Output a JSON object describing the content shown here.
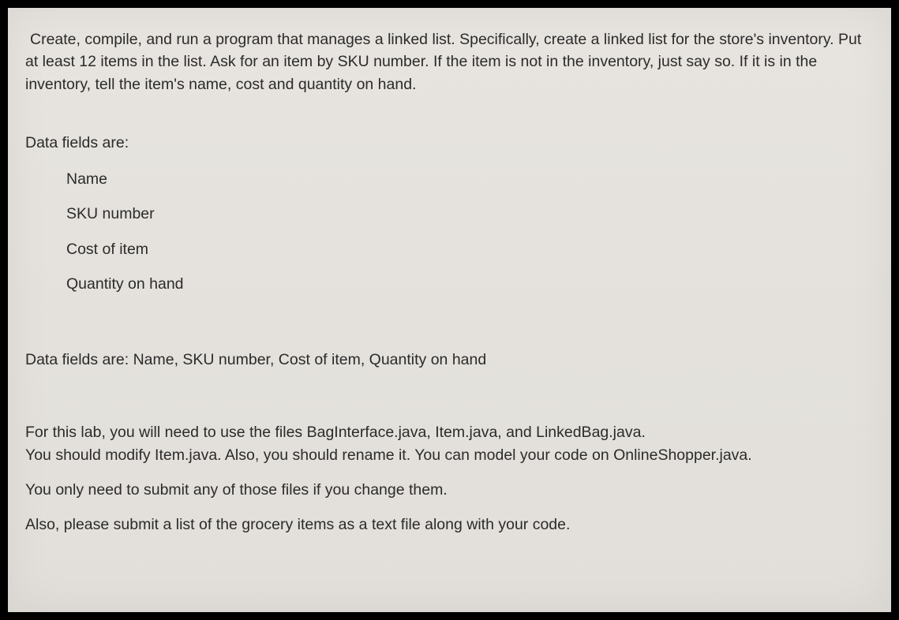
{
  "intro": "Create, compile, and run a program that manages a linked list.  Specifically, create a linked list for the store's inventory.  Put at least 12 items in the list.  Ask for an item by SKU number.  If the item is not in the inventory, just say so.  If it is in the inventory, tell the item's name, cost and quantity on hand.",
  "fieldsHeading": "Data fields are:",
  "fields": {
    "f0": "Name",
    "f1": "SKU number",
    "f2": "Cost of item",
    "f3": "Quantity on hand"
  },
  "summary": "Data fields are:  Name, SKU number, Cost of item, Quantity on hand",
  "instructions": {
    "p0": "For this lab, you will need to use the files BagInterface.java, Item.java, and LinkedBag.java.\nYou should modify Item.java.  Also, you should rename it.  You can model your code on OnlineShopper.java.",
    "p1": "You only need to submit any of those files if you change them.",
    "p2": "Also, please submit a list of the grocery items as a text file along with your code."
  }
}
